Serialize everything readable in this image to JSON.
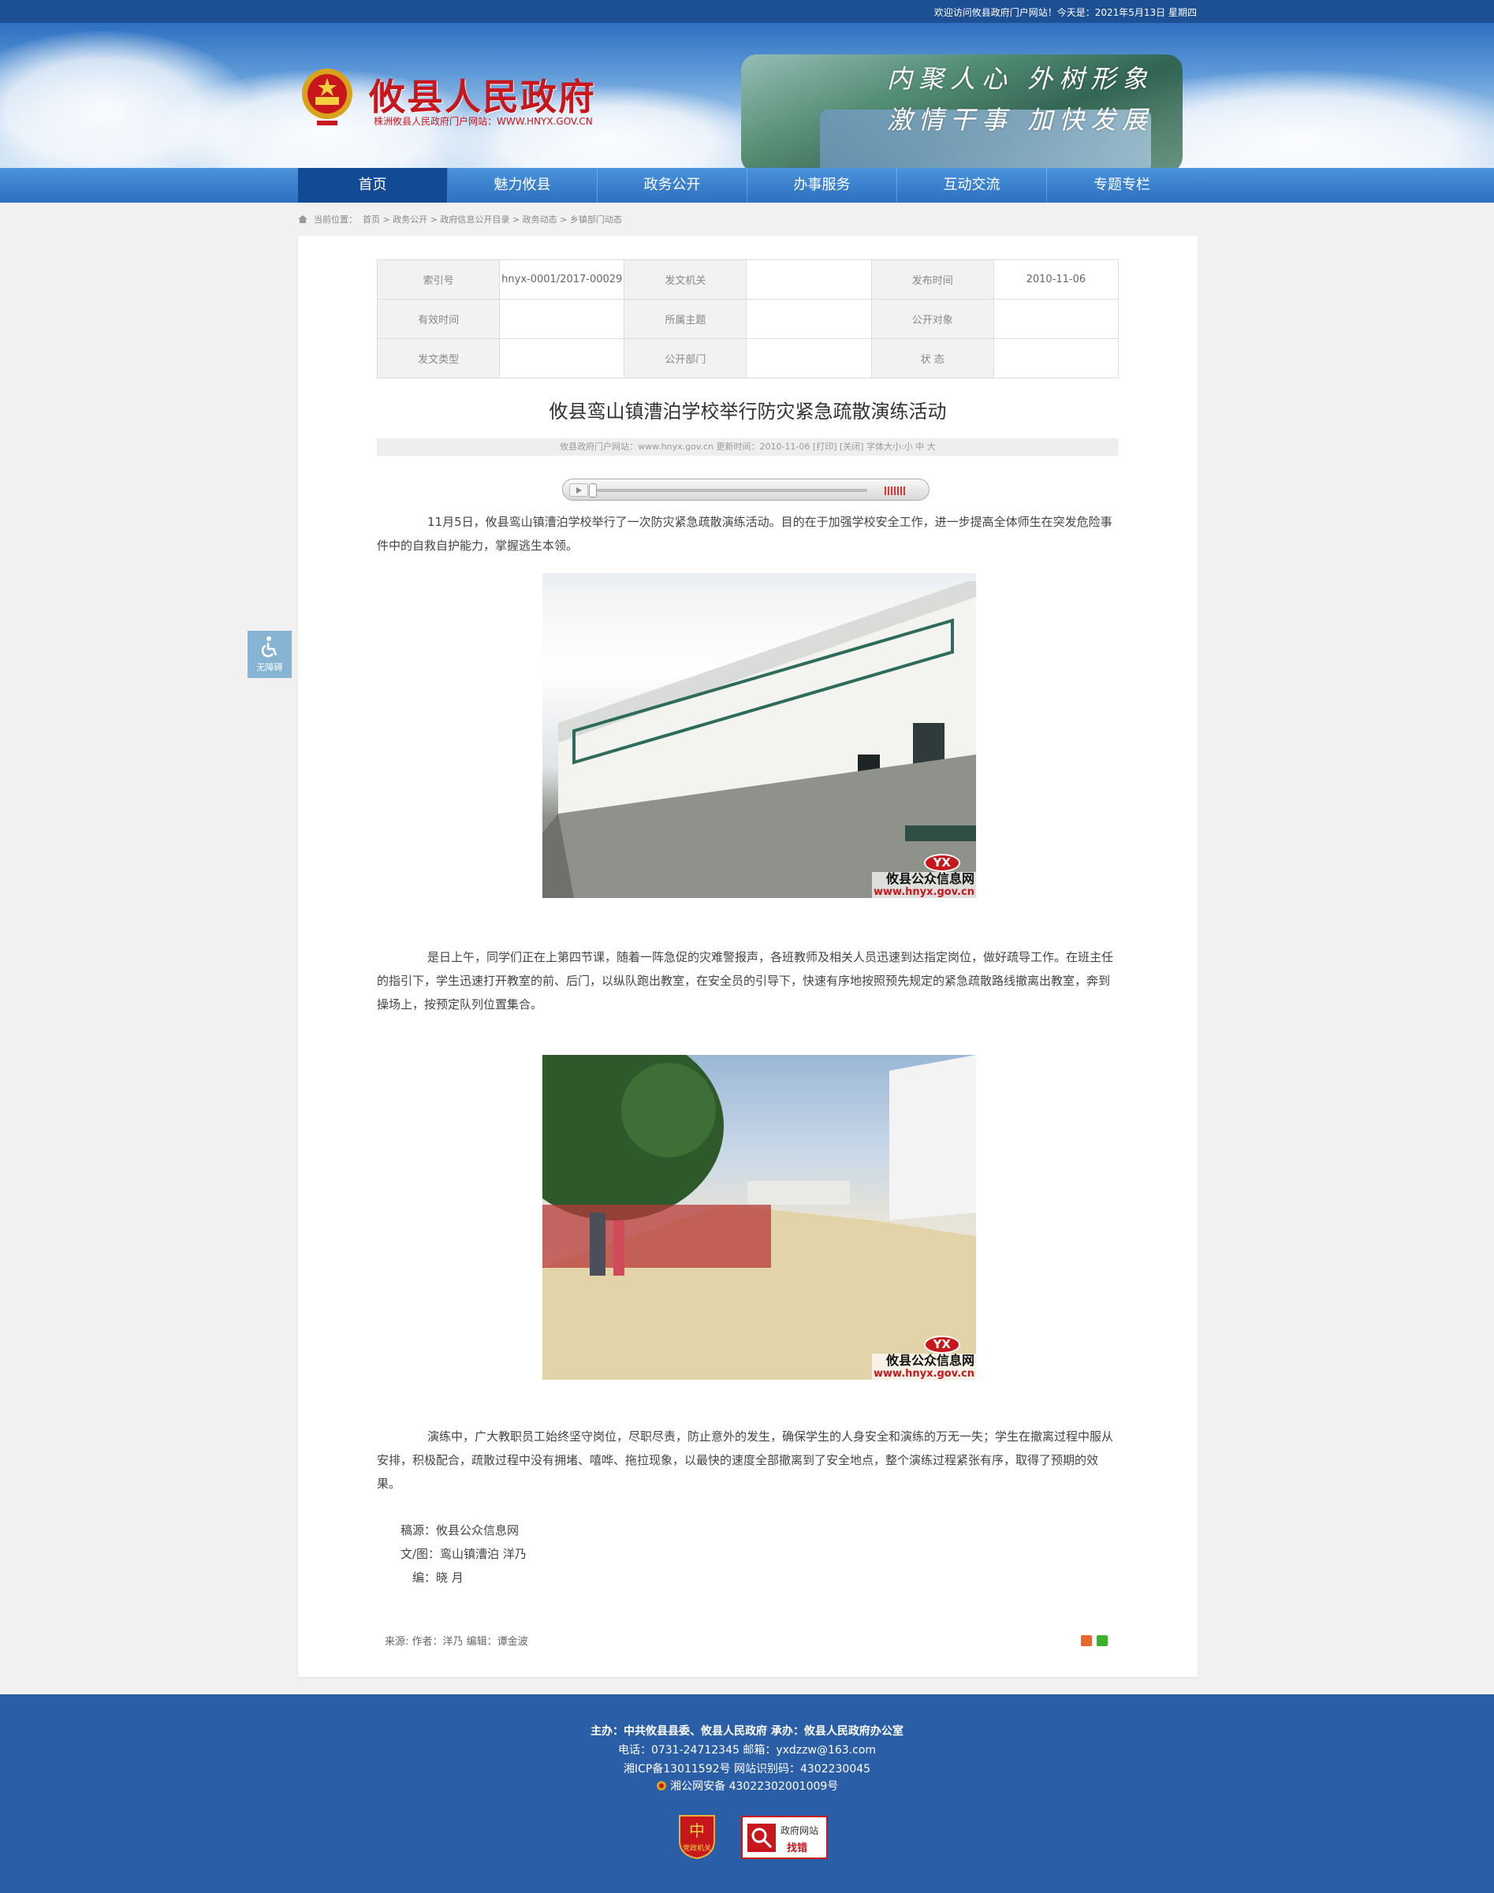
{
  "topbar": {
    "welcome": "欢迎访问攸县政府门户网站！今天是：2021年5月13日 星期四"
  },
  "header": {
    "site_title": "攸县人民政府",
    "site_subtitle": "株洲攸县人民政府门户网站：WWW.HNYX.GOV.CN",
    "slogan_line1": "内聚人心  外树形象",
    "slogan_line2": "激情干事  加快发展"
  },
  "nav": {
    "items": [
      "首页",
      "魅力攸县",
      "政务公开",
      "办事服务",
      "互动交流",
      "专题专栏"
    ],
    "active_index": 0
  },
  "breadcrumb": {
    "label": "当前位置：",
    "trail": "首页 > 政务公开 > 政府信息公开目录 > 政务动态 > 乡镇部门动态"
  },
  "meta": {
    "rows": [
      [
        {
          "label": "索引号",
          "value": "hnyx-0001/2017-00029"
        },
        {
          "label": "发文机关",
          "value": ""
        },
        {
          "label": "发布时间",
          "value": "2010-11-06"
        }
      ],
      [
        {
          "label": "有效时间",
          "value": ""
        },
        {
          "label": "所属主题",
          "value": ""
        },
        {
          "label": "公开对象",
          "value": ""
        }
      ],
      [
        {
          "label": "发文类型",
          "value": ""
        },
        {
          "label": "公开部门",
          "value": ""
        },
        {
          "label": "状 态",
          "value": ""
        }
      ]
    ]
  },
  "article": {
    "title": "攸县鸾山镇漕泊学校举行防灾紧急疏散演练活动",
    "info_line": "攸县政府门户网站：www.hnyx.gov.cn   更新时间：2010-11-06   [打印] [关闭]   字体大小:小 中 大",
    "para1": "11月5日，攸县鸾山镇漕泊学校举行了一次防灾紧急疏散演练活动。目的在于加强学校安全工作，进一步提高全体师生在突发危险事件中的自救自护能力，掌握逃生本领。",
    "para2": "是日上午，同学们正在上第四节课，随着一阵急促的灾难警报声，各班教师及相关人员迅速到达指定岗位，做好疏导工作。在班主任的指引下，学生迅速打开教室的前、后门，以纵队跑出教室，在安全员的引导下，快速有序地按照预先规定的紧急疏散路线撤离出教室，奔到操场上，按预定队列位置集合。",
    "para3": "演练中，广大教职员工始终坚守岗位，尽职尽责，防止意外的发生，确保学生的人身安全和演练的万无一失；学生在撤离过程中服从安排，积极配合，疏散过程中没有拥堵、嘻哗、拖拉现象，以最快的速度全部撤离到了安全地点，整个演练过程紧张有序，取得了预期的效果。",
    "watermark_logo": "YX",
    "watermark_name": "攸县公众信息网",
    "watermark_url": "www.hnyx.gov.cn",
    "credit_source": "稿源：攸县公众信息网",
    "credit_author": "文/图：鸾山镇漕泊 洋乃",
    "credit_editor": "编：晓   月",
    "footer_line": "来源:        作者：洋乃     编辑：谭金波"
  },
  "a11y": {
    "label": "无障碍"
  },
  "footer": {
    "line1": "主办：中共攸县县委、攸县人民政府  承办：攸县人民政府办公室",
    "line2": "电话：0731-24712345  邮箱：yxdzzw@163.com",
    "line3": "湘ICP备13011592号     网站识别码：4302230045",
    "line4": "湘公网安备 43022302001009号",
    "badge_gov": "党政机关",
    "badge_find_line1": "政府网站",
    "badge_find_line2": "找错"
  }
}
